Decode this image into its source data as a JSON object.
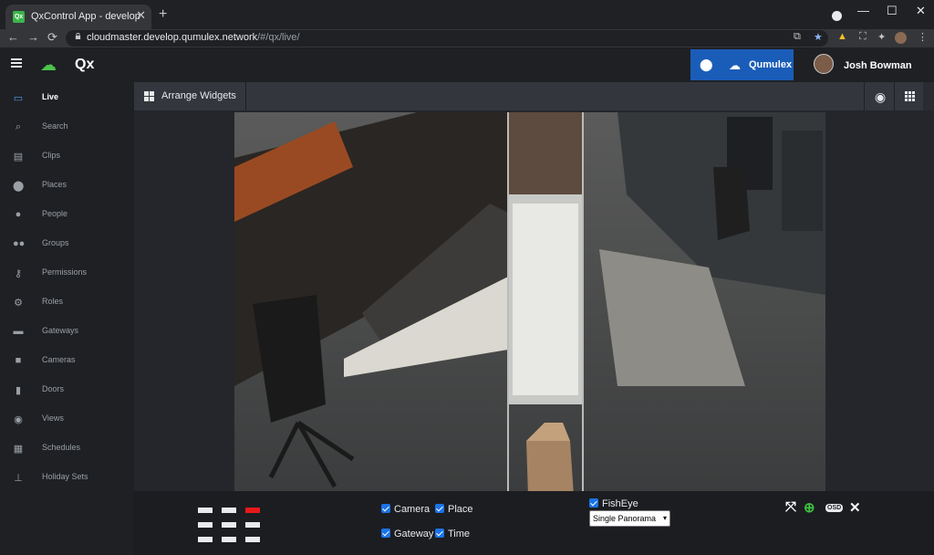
{
  "browser": {
    "tab_title": "QxControl App - develop",
    "favicon_text": "Qx",
    "tab_close": "✕",
    "new_tab": "+",
    "url_host": "cloudmaster.develop.qumulex.network",
    "url_path": "/#/qx/live/",
    "back": "←",
    "forward": "→",
    "reload": "⟳",
    "minimize": "—",
    "maximize": "☐",
    "close": "✕",
    "menu": "⋮"
  },
  "app": {
    "logo_text": "Qx",
    "tenant_name": "Qumulex",
    "user_name": "Josh Bowman"
  },
  "sidebar": {
    "items": [
      {
        "label": "Live",
        "icon": "monitor-icon",
        "glyph": "▭",
        "active": true
      },
      {
        "label": "Search",
        "icon": "search-icon",
        "glyph": "⌕"
      },
      {
        "label": "Clips",
        "icon": "file-icon",
        "glyph": "▤"
      },
      {
        "label": "Places",
        "icon": "map-pin-icon",
        "glyph": "⬤"
      },
      {
        "label": "People",
        "icon": "person-icon",
        "glyph": "●"
      },
      {
        "label": "Groups",
        "icon": "users-icon",
        "glyph": "●●"
      },
      {
        "label": "Permissions",
        "icon": "key-icon",
        "glyph": "⚷"
      },
      {
        "label": "Roles",
        "icon": "user-cog-icon",
        "glyph": "⚙"
      },
      {
        "label": "Gateways",
        "icon": "server-icon",
        "glyph": "▬"
      },
      {
        "label": "Cameras",
        "icon": "video-camera-icon",
        "glyph": "■"
      },
      {
        "label": "Doors",
        "icon": "door-icon",
        "glyph": "▮"
      },
      {
        "label": "Views",
        "icon": "eye-icon",
        "glyph": "◉"
      },
      {
        "label": "Schedules",
        "icon": "calendar-icon",
        "glyph": "▦"
      },
      {
        "label": "Holiday Sets",
        "icon": "holiday-icon",
        "glyph": "⊥"
      }
    ]
  },
  "toolbar": {
    "title": "Arrange Widgets"
  },
  "controls": {
    "camera_label": "Camera",
    "place_label": "Place",
    "gateway_label": "Gateway",
    "time_label": "Time",
    "fisheye_label": "FishEye",
    "panorama_selected": "Single Panorama",
    "osd_label": "OSD"
  },
  "colors": {
    "accent_blue": "#1a5db8",
    "brand_green": "#4cc34c",
    "layout_active_red": "#e8181a"
  }
}
